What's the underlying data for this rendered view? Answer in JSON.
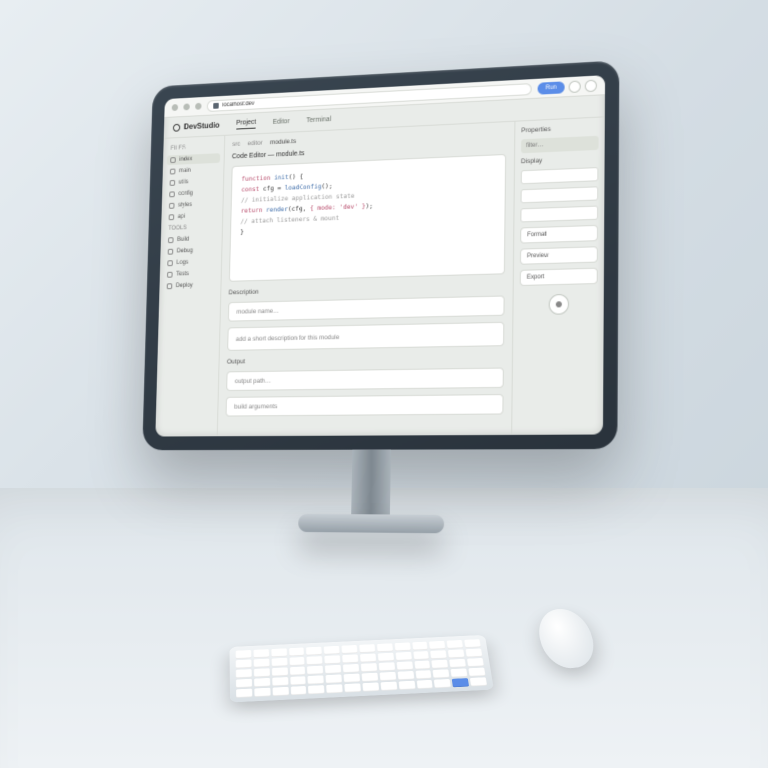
{
  "browser": {
    "url": "localhost:dev",
    "action_label": "Run"
  },
  "app": {
    "title": "DevStudio",
    "tabs": [
      "Project",
      "Editor",
      "Terminal"
    ]
  },
  "sidebar": {
    "section_a": "FILES",
    "items_a": [
      "index",
      "main",
      "utils",
      "config",
      "styles",
      "api"
    ],
    "section_b": "TOOLS",
    "items_b": [
      "Build",
      "Debug",
      "Logs",
      "Tests",
      "Deploy"
    ]
  },
  "main": {
    "crumbs": [
      "src",
      "editor",
      "module.ts"
    ],
    "editor_title": "Code Editor — module.ts",
    "code": {
      "l1a": "function",
      "l1b": " init",
      "l1c": "() {",
      "l2a": "  const",
      "l2b": " cfg = ",
      "l2c": "loadConfig",
      "l2d": "();",
      "l3a": "  // initialize application state",
      "l4a": "  return",
      "l4b": " render",
      "l4c": "(cfg, ",
      "l4d": "{ mode: 'dev' }",
      "l4e": ");",
      "l5a": "  // attach listeners & mount",
      "l6a": "}"
    },
    "section1_label": "Description",
    "field1_placeholder": "module name…",
    "field2_placeholder": "add a short description for this module",
    "section2_label": "Output",
    "field3_placeholder": "output path…",
    "field4_placeholder": "build arguments"
  },
  "panel": {
    "header": "Properties",
    "search_placeholder": "filter…",
    "group": "Display",
    "btn1": "Format",
    "btn2": "Preview",
    "btn3": "Export"
  }
}
